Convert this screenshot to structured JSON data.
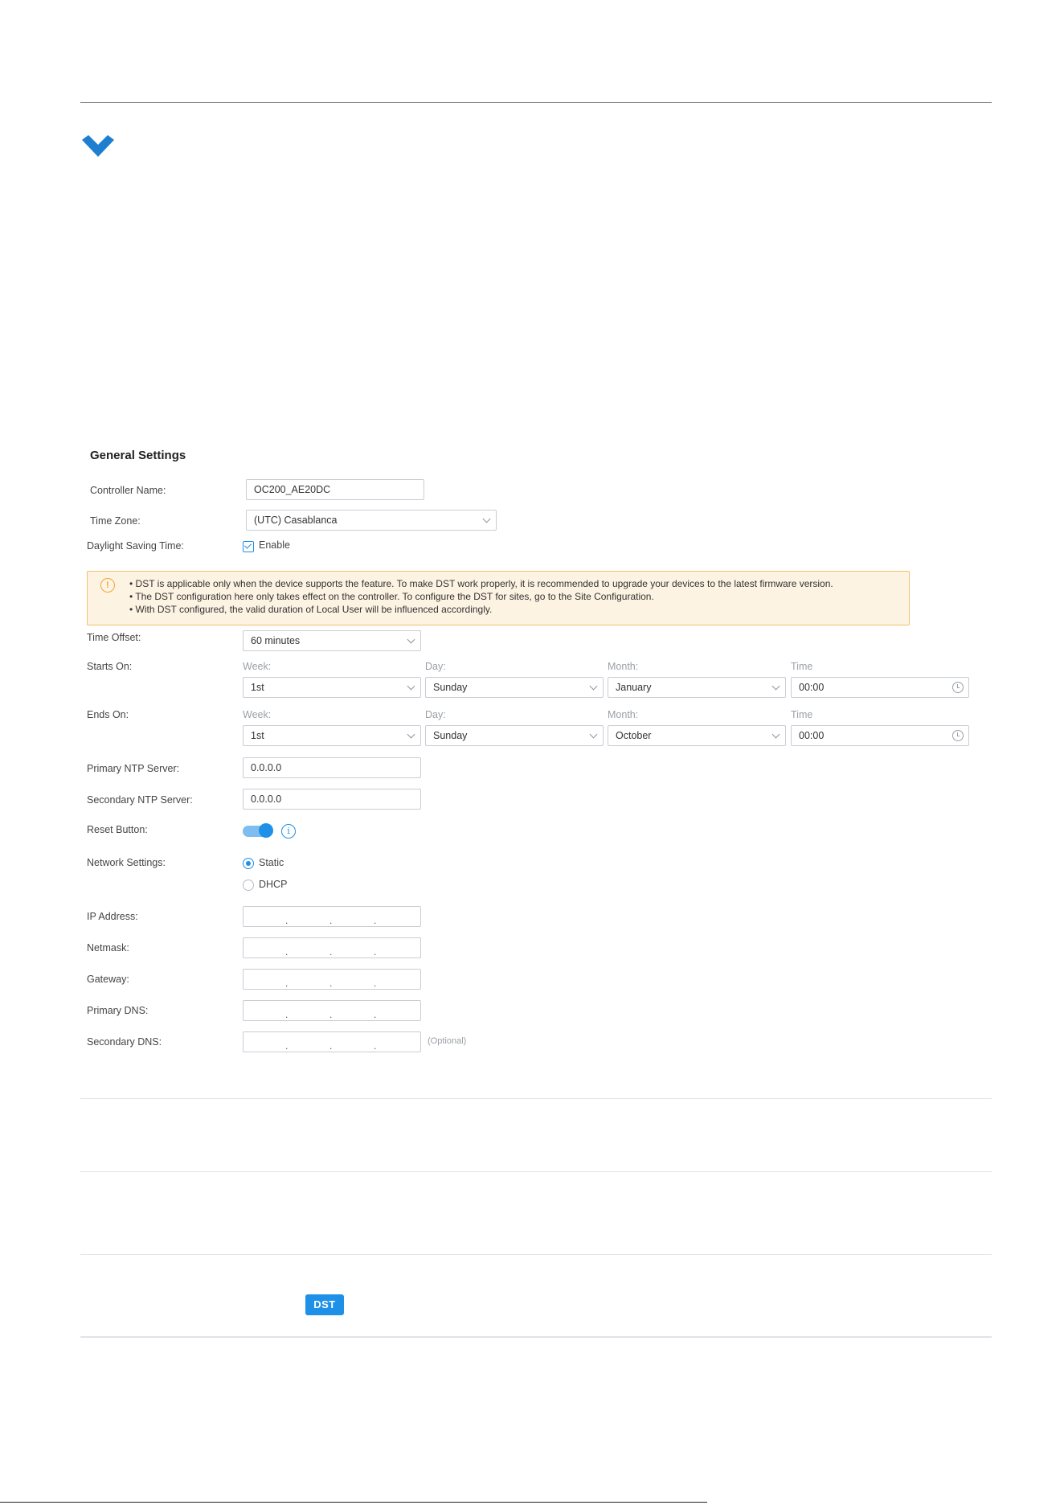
{
  "section_title": "General Settings",
  "controller_name": {
    "label": "Controller Name:",
    "value": "OC200_AE20DC"
  },
  "time_zone": {
    "label": "Time Zone:",
    "value": "(UTC) Casablanca"
  },
  "dst": {
    "label": "Daylight Saving Time:",
    "enable_label": "Enable",
    "checked": true
  },
  "notice": {
    "lines": [
      "• DST is applicable only when the device supports the feature. To make DST work properly, it is recommended to upgrade your devices to the latest firmware version.",
      "• The DST configuration here only takes effect on the controller. To configure the DST for sites, go to the Site Configuration.",
      "• With DST configured, the valid duration of Local User will be influenced accordingly."
    ]
  },
  "time_offset": {
    "label": "Time Offset:",
    "value": "60 minutes"
  },
  "columns": {
    "week": "Week:",
    "day": "Day:",
    "month": "Month:",
    "time": "Time"
  },
  "starts_on": {
    "label": "Starts On:",
    "week": "1st",
    "day": "Sunday",
    "month": "January",
    "time": "00:00"
  },
  "ends_on": {
    "label": "Ends On:",
    "week": "1st",
    "day": "Sunday",
    "month": "October",
    "time": "00:00"
  },
  "primary_ntp": {
    "label": "Primary NTP Server:",
    "value": "0.0.0.0"
  },
  "secondary_ntp": {
    "label": "Secondary NTP Server:",
    "value": "0.0.0.0"
  },
  "reset_button": {
    "label": "Reset Button:",
    "on": true
  },
  "network": {
    "label": "Network Settings:",
    "options": [
      "Static",
      "DHCP"
    ],
    "selected": "Static"
  },
  "ip_fields": {
    "ip_address": "IP Address:",
    "netmask": "Netmask:",
    "gateway": "Gateway:",
    "primary_dns": "Primary DNS:",
    "secondary_dns": "Secondary DNS:",
    "optional_note": "(Optional)"
  },
  "badge": "DST",
  "colors": {
    "accent": "#1e90e8",
    "warning_bg": "#fdf3e2",
    "warning_border": "#f3bf6d"
  }
}
